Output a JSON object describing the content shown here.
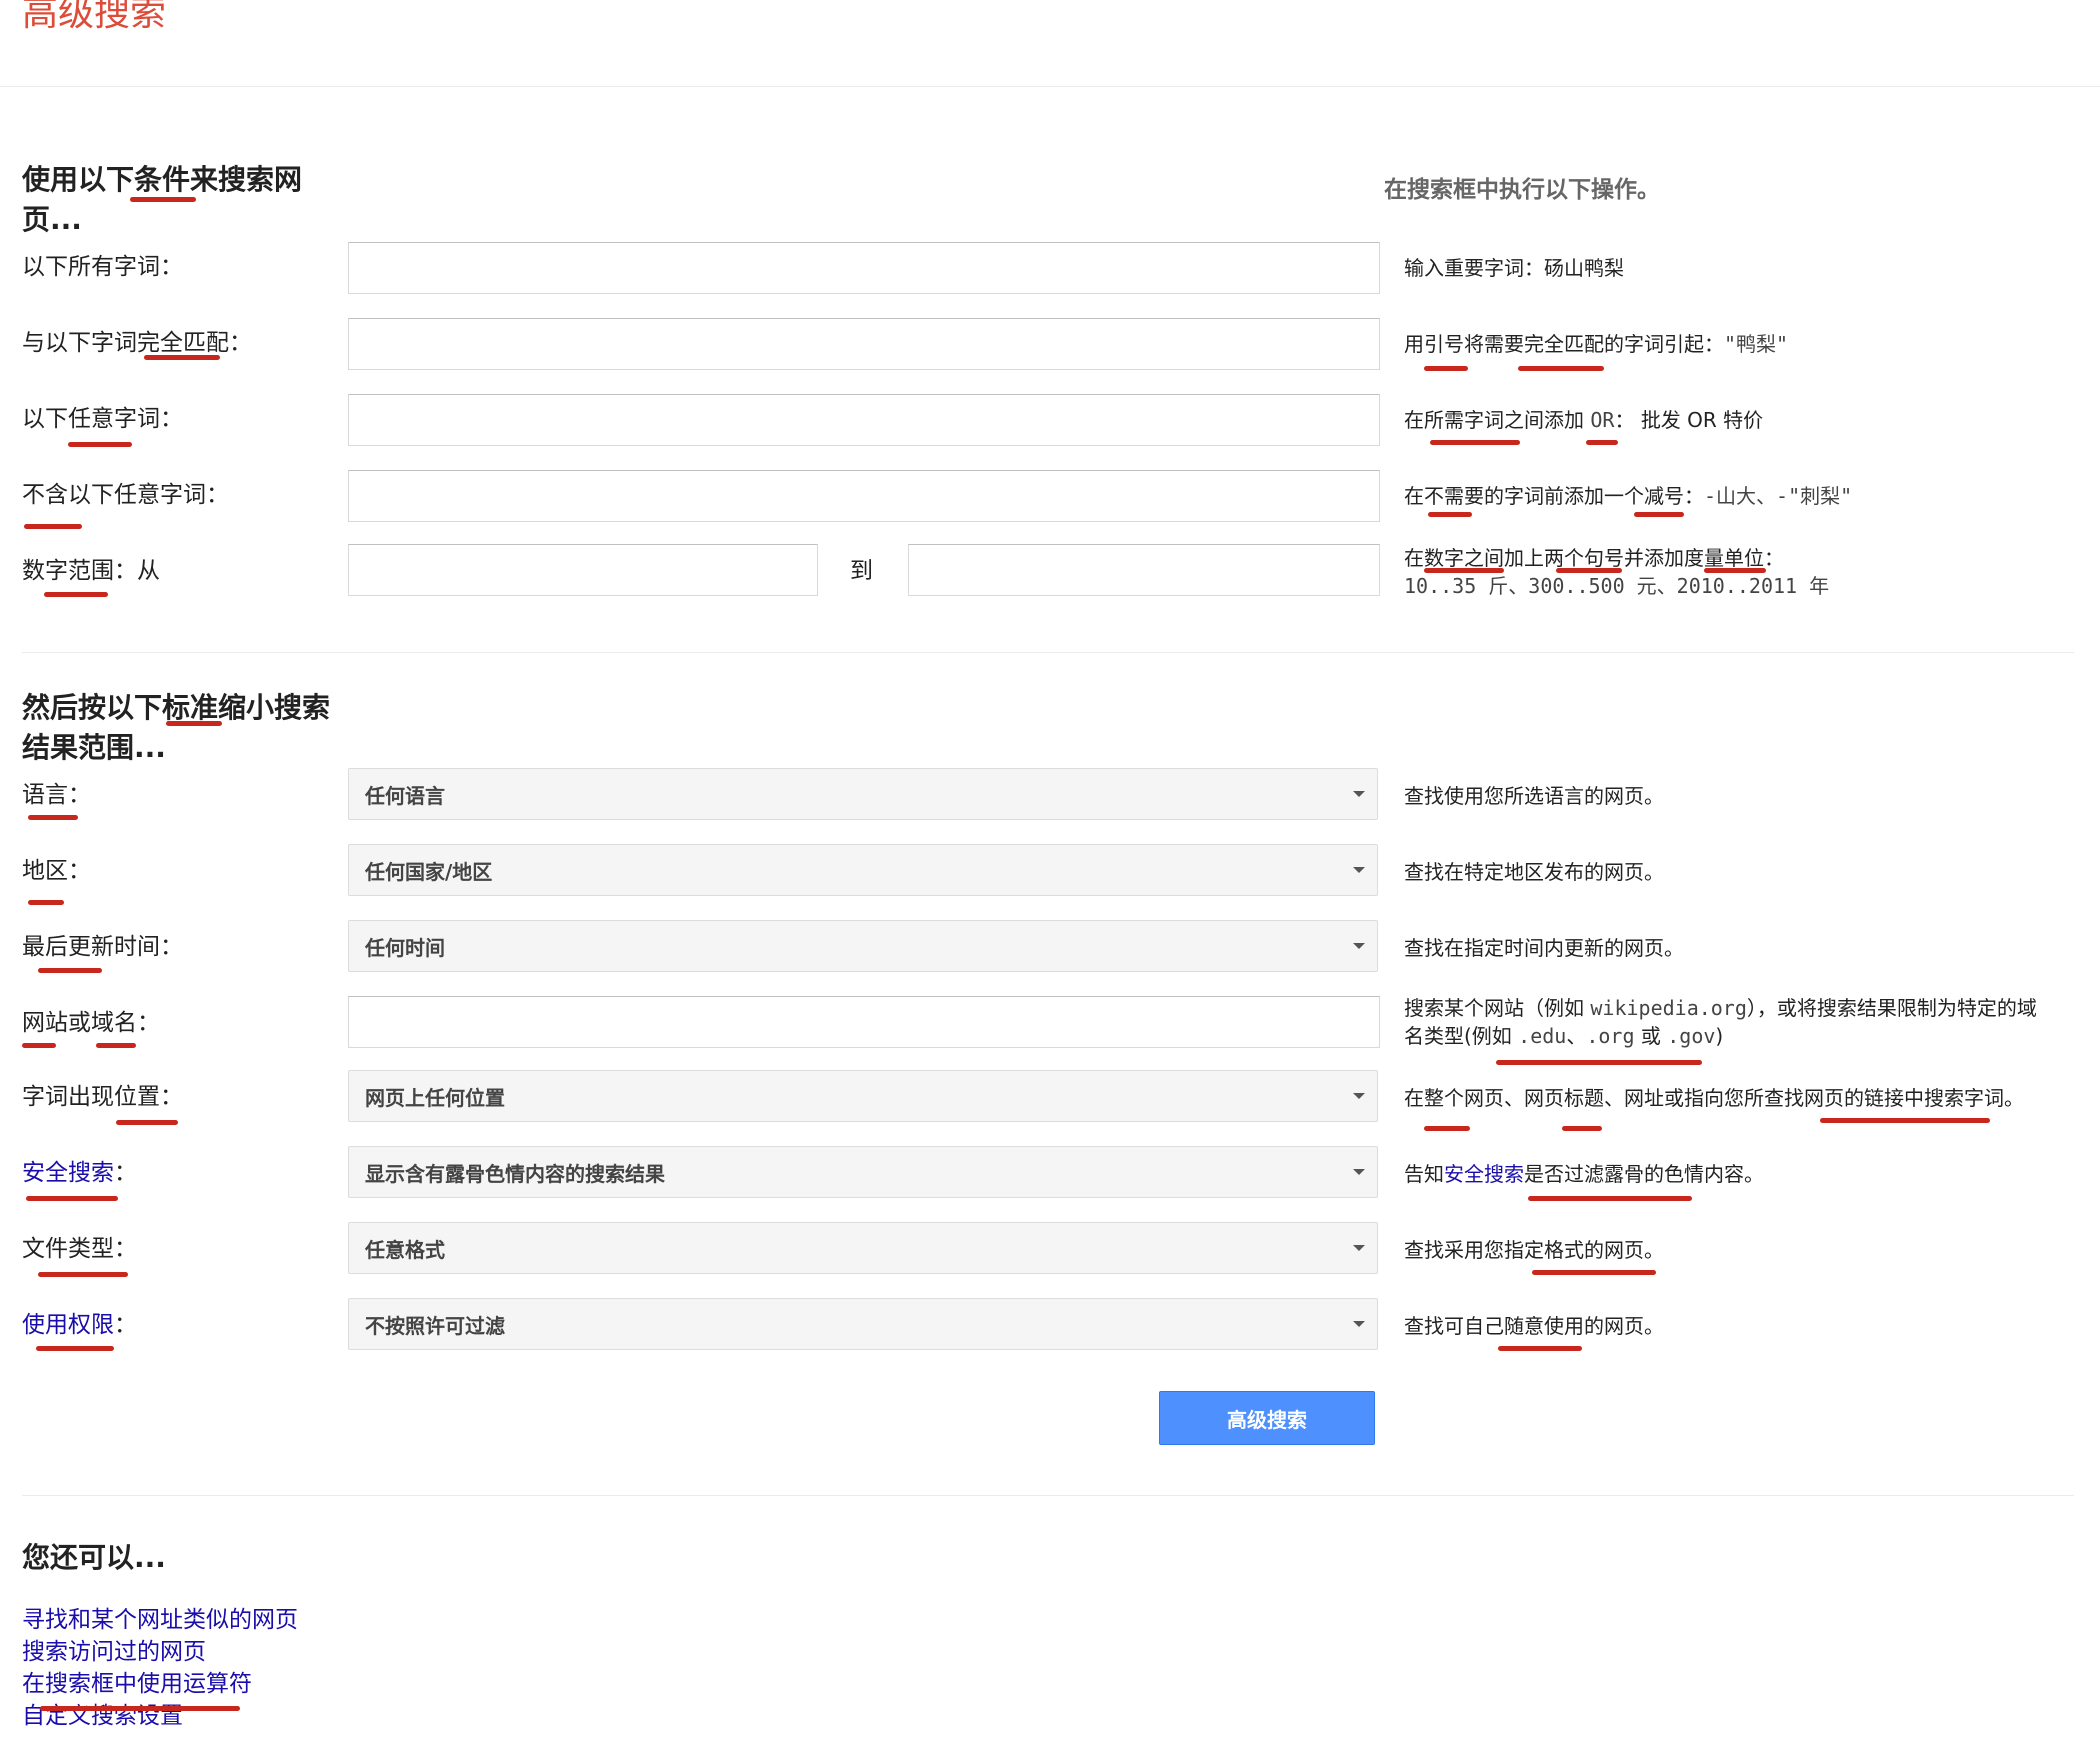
{
  "page_title": "高级搜索",
  "find_pages": {
    "heading_line1": "使用以下条件来搜索网",
    "heading_line2": "页...",
    "ops_heading": "在搜索框中执行以下操作。",
    "rows": [
      {
        "label": "以下所有字词：",
        "hint": "输入重要字词：",
        "hint_example": "砀山鸭梨"
      },
      {
        "label": "与以下字词完全匹配：",
        "hint": "用引号将需要完全匹配的字词引起：",
        "hint_example": "\"鸭梨\""
      },
      {
        "label": "以下任意字词：",
        "hint": "在所需字词之间添加",
        "hint_op": "OR",
        "hint_sep": "：",
        "hint_example": "批发 OR 特价"
      },
      {
        "label": "不含以下任意字词：",
        "hint": "在不需要的字词前添加一个减号：",
        "hint_example": "-山大、-\"刺梨\""
      }
    ],
    "range": {
      "label": "数字范围：从",
      "to_label": "到",
      "hint_line1": "在数字之间加上两个句号并添加度量单位：",
      "hint_line2": "10..35 斤、300..500 元、2010..2011 年"
    }
  },
  "narrow": {
    "heading_line1": "然后按以下标准缩小搜索",
    "heading_line2": "结果范围...",
    "language": {
      "label": "语言：",
      "value": "任何语言",
      "hint": "查找使用您所选语言的网页。"
    },
    "region": {
      "label": "地区：",
      "value": "任何国家/地区",
      "hint": "查找在特定地区发布的网页。"
    },
    "last_update": {
      "label": "最后更新时间：",
      "value": "任何时间",
      "hint": "查找在指定时间内更新的网页。"
    },
    "site": {
      "label": "网站或域名：",
      "hint_a": "搜索某个网站（例如",
      "hint_example": "wikipedia.org",
      "hint_b": "），或将搜索结果限制为特定的域",
      "hint_c": "名类型(例如",
      "hint_edu": ".edu",
      "hint_sep": "、",
      "hint_org": ".org",
      "hint_or": "或",
      "hint_gov": ".gov",
      "hint_d": ")"
    },
    "terms_appearing": {
      "label": "字词出现位置：",
      "value": "网页上任何位置",
      "hint": "在整个网页、网页标题、网址或指向您所查找网页的链接中搜索字词。"
    },
    "safesearch": {
      "label": "安全搜索",
      "colon": "：",
      "value": "显示含有露骨色情内容的搜索结果",
      "hint_a": "告知",
      "hint_link": "安全搜索",
      "hint_b": "是否过滤露骨的色情内容。"
    },
    "file_type": {
      "label": "文件类型：",
      "value": "任意格式",
      "hint": "查找采用您指定格式的网页。"
    },
    "usage_rights": {
      "label": "使用权限",
      "colon": "：",
      "value": "不按照许可过滤",
      "hint": "查找可自己随意使用的网页。"
    },
    "submit_label": "高级搜索"
  },
  "also": {
    "heading": "您还可以...",
    "links": [
      "寻找和某个网址类似的网页",
      "搜索访问过的网页",
      "在搜索框中使用运算符",
      "自定义搜索设置"
    ]
  },
  "colors": {
    "title_red": "#dd4b39",
    "link_blue": "#1a0dab",
    "button_blue": "#4d90fe",
    "annotation_red": "#c8271d"
  }
}
